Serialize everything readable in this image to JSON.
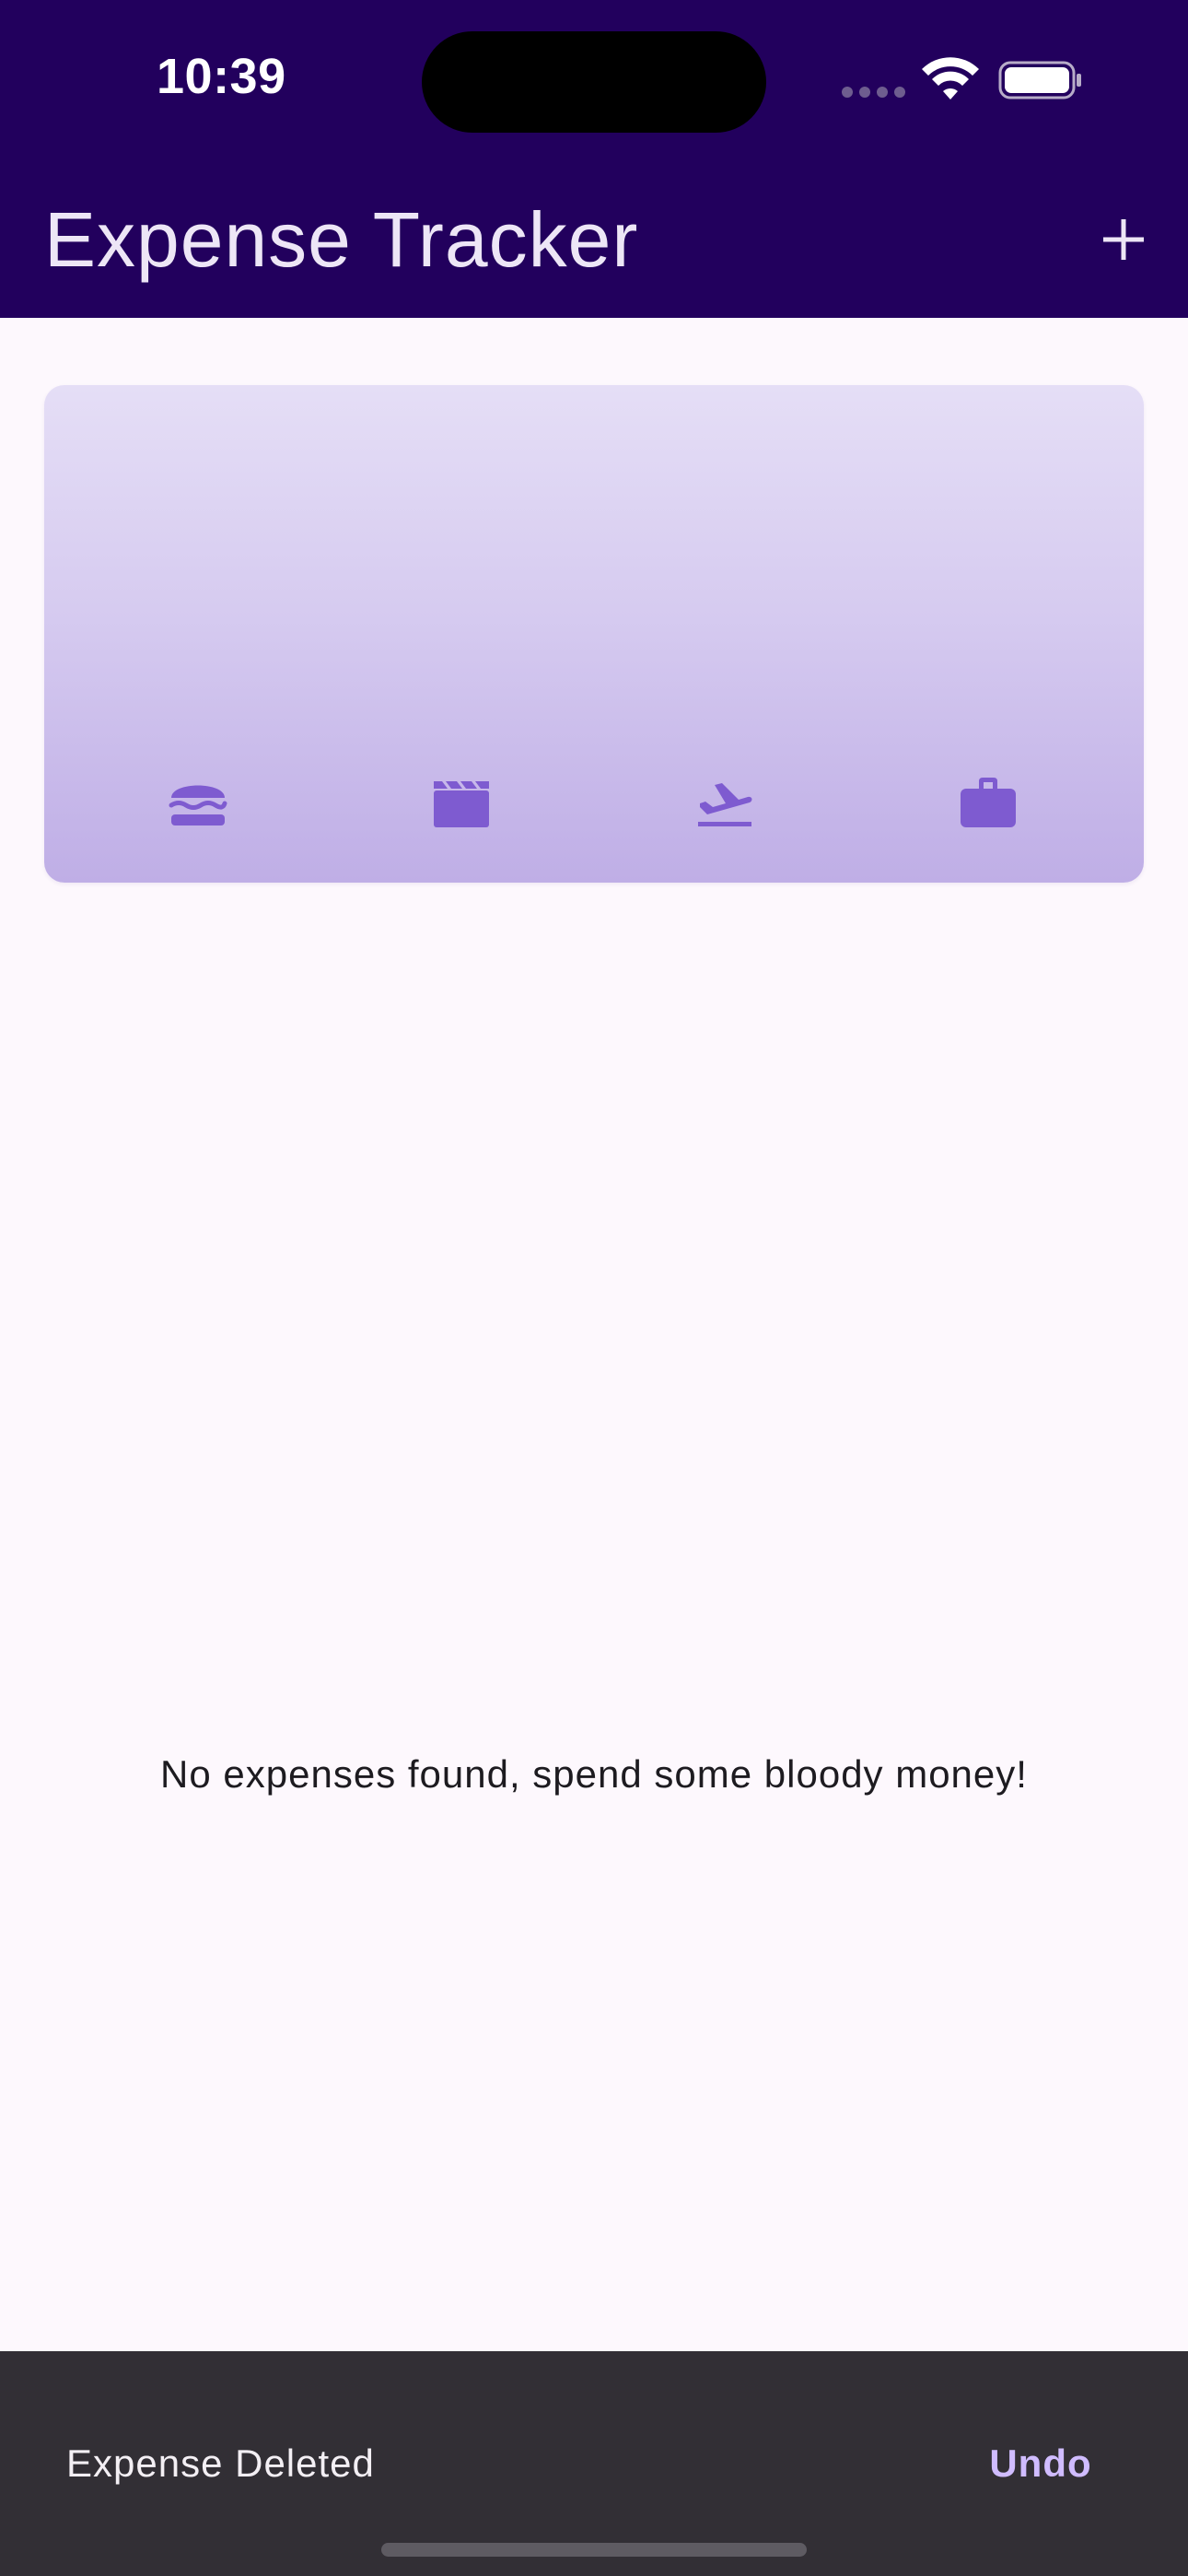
{
  "status_bar": {
    "time": "10:39",
    "icons": [
      "cellular-signal-icon",
      "wifi-icon",
      "battery-icon"
    ]
  },
  "app_bar": {
    "title": "Expense Tracker",
    "action_icon": "plus-icon",
    "background_color": "#22005d"
  },
  "chart_card": {
    "categories": [
      {
        "id": "food",
        "icon": "hamburger-icon"
      },
      {
        "id": "leisure",
        "icon": "movie-clapperboard-icon"
      },
      {
        "id": "travel",
        "icon": "flight-takeoff-icon"
      },
      {
        "id": "work",
        "icon": "briefcase-icon"
      }
    ],
    "icon_color": "#7e5bd0"
  },
  "main": {
    "empty_message": "No expenses found, spend some bloody money!"
  },
  "snackbar": {
    "message": "Expense Deleted",
    "action_label": "Undo",
    "action_color": "#d0bcff"
  }
}
